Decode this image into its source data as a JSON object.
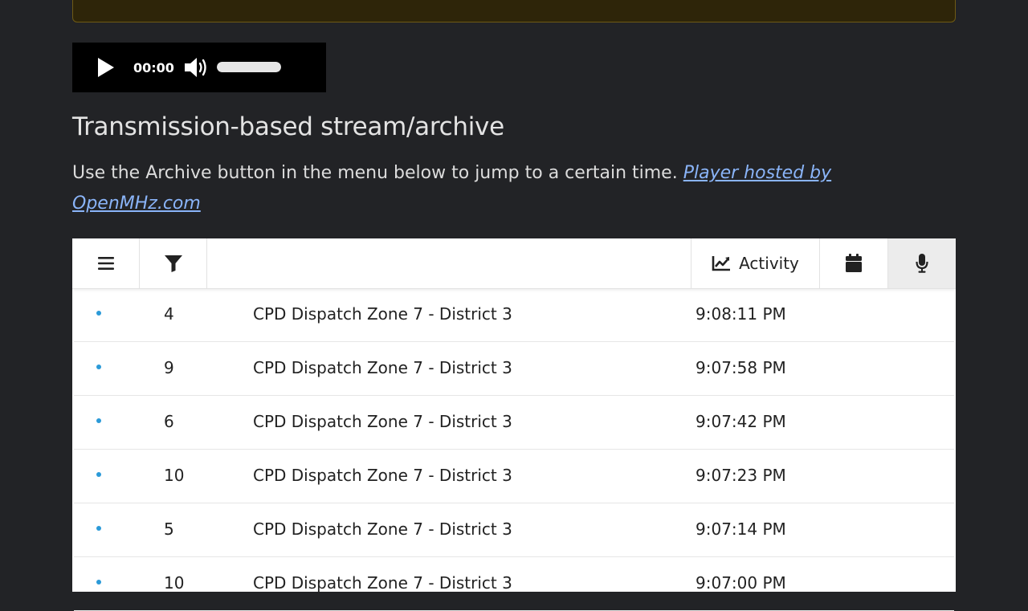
{
  "audio_player": {
    "current_time": "00:00",
    "volume_level": 1.0
  },
  "section": {
    "title": "Transmission-based stream/archive",
    "description": "Use the Archive button in the menu below to jump to a certain time. ",
    "link_text": "Player hosted by OpenMHz.com"
  },
  "toolbar": {
    "menu_icon": "bars-icon",
    "filter_icon": "filter-icon",
    "activity_icon": "chart-line-icon",
    "activity_label": "Activity",
    "calendar_icon": "calendar-icon",
    "mic_icon": "microphone-icon"
  },
  "colors": {
    "page_bg": "#222326",
    "banner_bg": "#2e2509",
    "link": "#8ab4f8",
    "dot": "#2b9ad8"
  },
  "calls": [
    {
      "unit": "4",
      "talkgroup": "CPD Dispatch Zone 7 - District 3",
      "time": "9:08:11 PM"
    },
    {
      "unit": "9",
      "talkgroup": "CPD Dispatch Zone 7 - District 3",
      "time": "9:07:58 PM"
    },
    {
      "unit": "6",
      "talkgroup": "CPD Dispatch Zone 7 - District 3",
      "time": "9:07:42 PM"
    },
    {
      "unit": "10",
      "talkgroup": "CPD Dispatch Zone 7 - District 3",
      "time": "9:07:23 PM"
    },
    {
      "unit": "5",
      "talkgroup": "CPD Dispatch Zone 7 - District 3",
      "time": "9:07:14 PM"
    },
    {
      "unit": "10",
      "talkgroup": "CPD Dispatch Zone 7 - District 3",
      "time": "9:07:00 PM"
    }
  ]
}
